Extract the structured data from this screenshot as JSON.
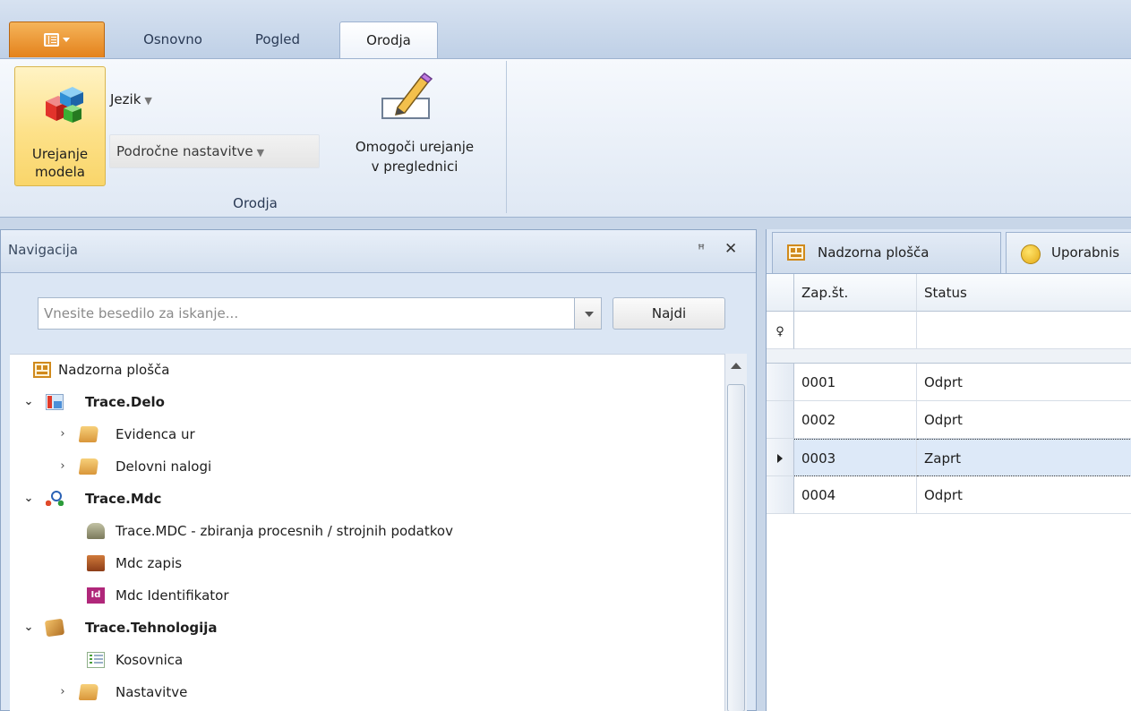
{
  "tabs": {
    "osnovno": "Osnovno",
    "pogled": "Pogled",
    "orodja": "Orodja"
  },
  "ribbon": {
    "urejanje_line1": "Urejanje",
    "urejanje_line2": "modela",
    "jezik": "Jezik",
    "podrocne": "Področne nastavitve",
    "omogoci_line1": "Omogoči urejanje",
    "omogoci_line2": "v preglednici",
    "group_label": "Orodja"
  },
  "nav": {
    "title": "Navigacija",
    "search_placeholder": "Vnesite besedilo za iskanje...",
    "find_button": "Najdi",
    "tree": [
      {
        "label": "Nadzorna plošča",
        "icon": "dashboard-icon"
      },
      {
        "label": "Trace.Delo",
        "icon": "chart-icon"
      },
      {
        "label": "Evidenca ur",
        "icon": "folder-icon"
      },
      {
        "label": "Delovni nalogi",
        "icon": "folder-icon"
      },
      {
        "label": "Trace.Mdc",
        "icon": "network-icon"
      },
      {
        "label": "Trace.MDC - zbiranja procesnih / strojnih podatkov",
        "icon": "machine-icon"
      },
      {
        "label": "Mdc zapis",
        "icon": "box-icon"
      },
      {
        "label": "Mdc Identifikator",
        "icon": "id-icon",
        "icon_text": "Id"
      },
      {
        "label": "Trace.Tehnologija",
        "icon": "cubes-icon"
      },
      {
        "label": "Kosovnica",
        "icon": "list-icon"
      },
      {
        "label": "Nastavitve",
        "icon": "folder-icon"
      }
    ]
  },
  "right": {
    "tab_dashboard": "Nadzorna plošča",
    "tab_users": "Uporabnis",
    "columns": {
      "zap": "Zap.št.",
      "status": "Status"
    },
    "rows": [
      {
        "zap": "0001",
        "status": "Odprt"
      },
      {
        "zap": "0002",
        "status": "Odprt"
      },
      {
        "zap": "0003",
        "status": "Zaprt"
      },
      {
        "zap": "0004",
        "status": "Odprt"
      }
    ],
    "selected_row_index": 2
  },
  "colors": {
    "app_button": "#e4821c",
    "annotation_red": "#e0141e",
    "selection": "#dde9f8"
  }
}
